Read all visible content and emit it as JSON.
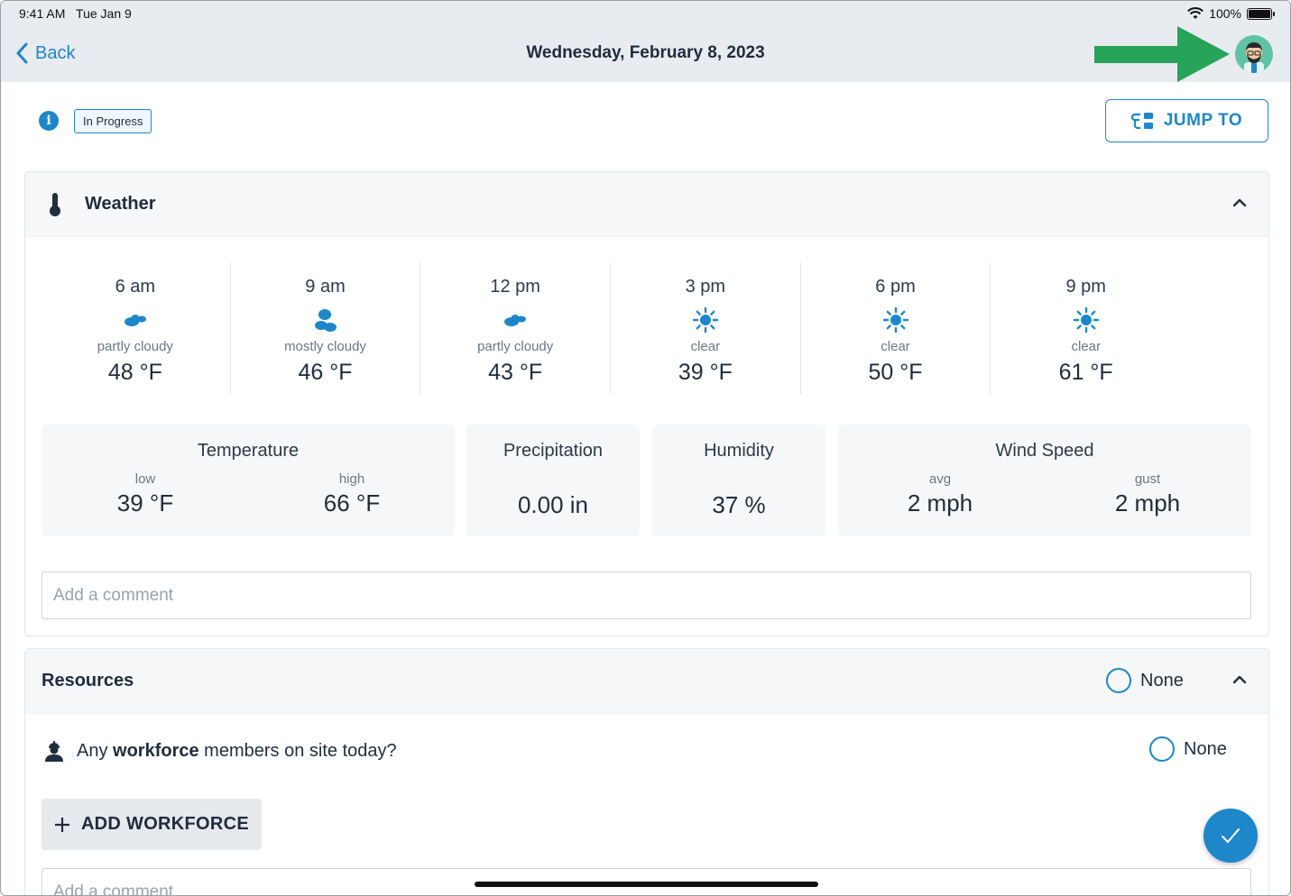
{
  "status": {
    "time": "9:41 AM",
    "date": "Tue Jan 9",
    "battery": "100%"
  },
  "nav": {
    "back_label": "Back",
    "title": "Wednesday, February 8, 2023"
  },
  "header": {
    "status_badge": "In Progress",
    "jump_label": "JUMP TO"
  },
  "weather": {
    "title": "Weather",
    "hours": [
      {
        "time": "6 am",
        "icon": "partly-cloudy-icon",
        "condition": "partly cloudy",
        "temp": "48 °F"
      },
      {
        "time": "9 am",
        "icon": "mostly-cloudy-icon",
        "condition": "mostly cloudy",
        "temp": "46 °F"
      },
      {
        "time": "12 pm",
        "icon": "partly-cloudy-icon",
        "condition": "partly cloudy",
        "temp": "43 °F"
      },
      {
        "time": "3 pm",
        "icon": "sun-icon",
        "condition": "clear",
        "temp": "39 °F"
      },
      {
        "time": "6 pm",
        "icon": "sun-icon",
        "condition": "clear",
        "temp": "50 °F"
      },
      {
        "time": "9 pm",
        "icon": "sun-icon",
        "condition": "clear",
        "temp": "61 °F"
      }
    ],
    "temperature": {
      "title": "Temperature",
      "low_label": "low",
      "low": "39 °F",
      "high_label": "high",
      "high": "66 °F"
    },
    "precipitation": {
      "title": "Precipitation",
      "value": "0.00 in"
    },
    "humidity": {
      "title": "Humidity",
      "value": "37 %"
    },
    "wind": {
      "title": "Wind Speed",
      "avg_label": "avg",
      "avg": "2 mph",
      "gust_label": "gust",
      "gust": "2 mph"
    },
    "comment_placeholder": "Add a comment"
  },
  "resources": {
    "title": "Resources",
    "none_label": "None",
    "workforce_prefix": "Any ",
    "workforce_bold": "workforce",
    "workforce_suffix": " members on site today?",
    "workforce_none_label": "None",
    "add_label": "ADD WORKFORCE",
    "comment_placeholder": "Add a comment"
  },
  "colors": {
    "accent": "#1d87c9",
    "arrow": "#27a35a",
    "header_bg": "#e8ebef"
  }
}
